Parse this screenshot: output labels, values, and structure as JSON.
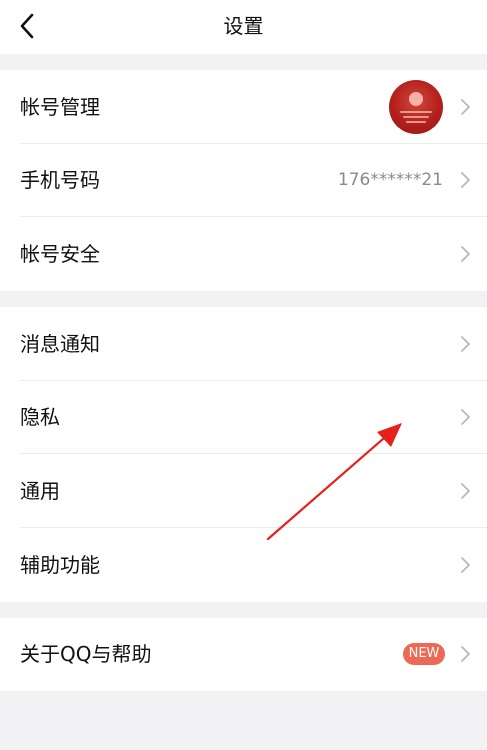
{
  "header": {
    "title": "设置"
  },
  "groups": [
    {
      "items": [
        {
          "label": "帐号管理",
          "trailing": "avatar"
        },
        {
          "label": "手机号码",
          "value": "176******21"
        },
        {
          "label": "帐号安全"
        }
      ]
    },
    {
      "items": [
        {
          "label": "消息通知"
        },
        {
          "label": "隐私"
        },
        {
          "label": "通用"
        },
        {
          "label": "辅助功能"
        }
      ]
    },
    {
      "items": [
        {
          "label": "关于QQ与帮助",
          "badge": "NEW"
        }
      ]
    }
  ],
  "icons": {
    "back": "chevron-left-icon",
    "row_trailing": "chevron-right-icon",
    "annotation": "red-arrow-annotation"
  },
  "colors": {
    "page_background": "#f2f2f4",
    "row_background": "#ffffff",
    "primary_text": "#111111",
    "secondary_text": "#8a8a8e",
    "chevron": "#b8b8bc",
    "badge": "#ec6a55",
    "avatar": "#b41f1c",
    "annotation_arrow": "#e8201a"
  }
}
